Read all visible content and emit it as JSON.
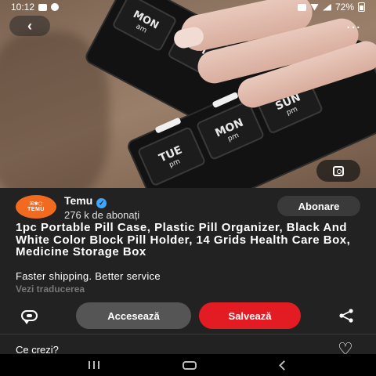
{
  "status_bar": {
    "time": "10:12",
    "battery": "72%"
  },
  "photo": {
    "compartments": [
      {
        "day": "MON",
        "period": "am"
      },
      {
        "day": "MON",
        "period": "pm"
      },
      {
        "day": "SUN",
        "period": "pm"
      },
      {
        "day": "TUE",
        "period": "pm"
      },
      {
        "day": "M",
        "period": ""
      }
    ]
  },
  "channel": {
    "avatar_glyph": "ꕤ✱⬡",
    "avatar_wordmark": "TEMU",
    "name": "Temu",
    "subscribers": "276 k de abonați",
    "subscribe_label": "Abonare"
  },
  "post": {
    "title": "1pc Portable Pill Case, Plastic Pill Organizer, Black And White Color Block Pill Holder, 14 Grids Health Care Box, Medicine Storage Box",
    "subtitle": "Faster shipping. Better service",
    "translate_label": "Vezi traducerea"
  },
  "actions": {
    "access_label": "Accesează",
    "save_label": "Salvează"
  },
  "comments": {
    "prompt": "Ce crezi?"
  },
  "colors": {
    "save_button": "#e31b23",
    "avatar": "#f26a1f",
    "verified": "#3ea6ff"
  }
}
